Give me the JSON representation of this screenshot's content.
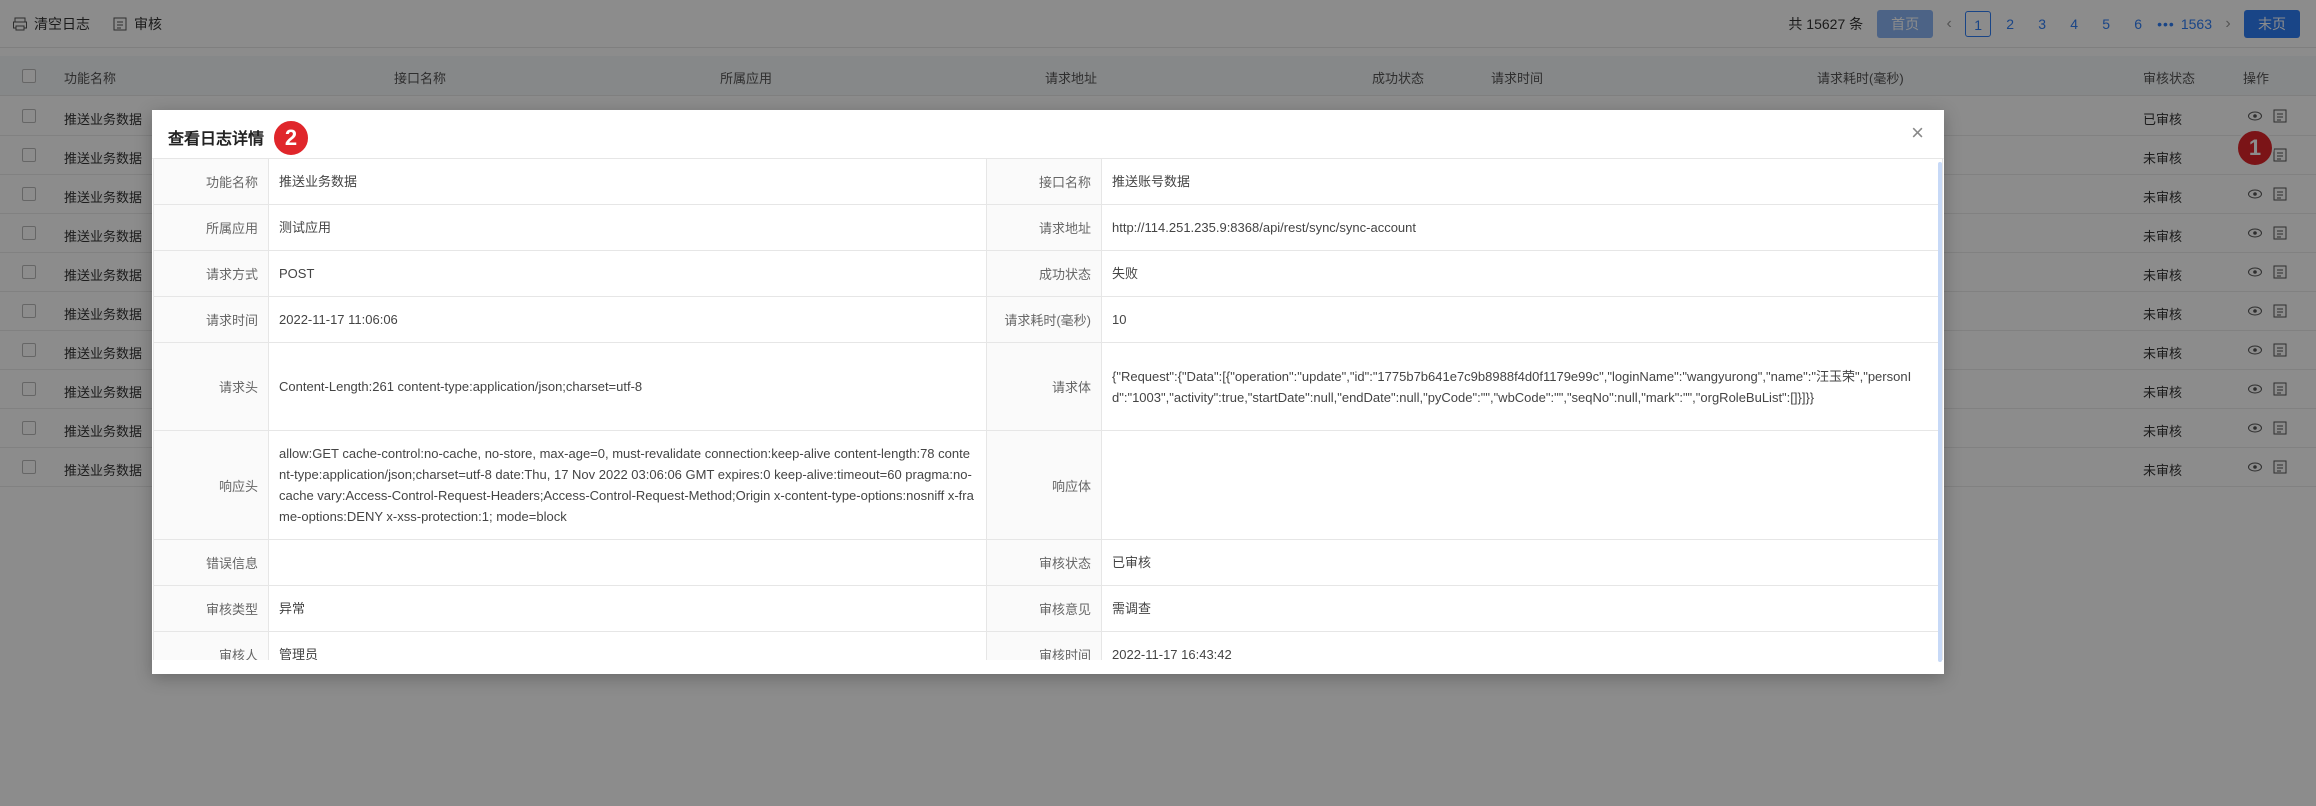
{
  "toolbar": {
    "clear_log_label": "清空日志",
    "audit_label": "审核"
  },
  "pagination": {
    "total": "共 15627 条",
    "first_label": "首页",
    "pages": [
      "1",
      "2",
      "3",
      "4",
      "5",
      "6"
    ],
    "ellipsis": "•••",
    "last_page": "1563",
    "last_label": "末页"
  },
  "table": {
    "headers": [
      "功能名称",
      "接口名称",
      "所属应用",
      "请求地址",
      "成功状态",
      "请求时间",
      "请求耗时(毫秒)",
      "审核状态",
      "操作"
    ],
    "rows": [
      {
        "name": "推送业务数据",
        "status": "已审核"
      },
      {
        "name": "推送业务数据",
        "status": "未审核"
      },
      {
        "name": "推送业务数据",
        "status": "未审核"
      },
      {
        "name": "推送业务数据",
        "status": "未审核"
      },
      {
        "name": "推送业务数据",
        "status": "未审核"
      },
      {
        "name": "推送业务数据",
        "status": "未审核"
      },
      {
        "name": "推送业务数据",
        "status": "未审核"
      },
      {
        "name": "推送业务数据",
        "status": "未审核"
      },
      {
        "name": "推送业务数据",
        "status": "未审核"
      },
      {
        "name": "推送业务数据",
        "status": "未审核"
      }
    ]
  },
  "badges": {
    "one": "1",
    "two": "2"
  },
  "modal": {
    "title": "查看日志详情",
    "close": "×",
    "fields": [
      {
        "label_l": "功能名称",
        "value_l": "推送业务数据",
        "label_r": "接口名称",
        "value_r": "推送账号数据"
      },
      {
        "label_l": "所属应用",
        "value_l": "测试应用",
        "label_r": "请求地址",
        "value_r": "http://114.251.235.9:8368/api/rest/sync/sync-account"
      },
      {
        "label_l": "请求方式",
        "value_l": "POST",
        "label_r": "成功状态",
        "value_r": "失败"
      },
      {
        "label_l": "请求时间",
        "value_l": "2022-11-17 11:06:06",
        "label_r": "请求耗时(毫秒)",
        "value_r": "10"
      },
      {
        "label_l": "请求头",
        "value_l": "Content-Length:261 content-type:application/json;charset=utf-8",
        "label_r": "请求体",
        "value_r": "{\"Request\":{\"Data\":[{\"operation\":\"update\",\"id\":\"1775b7b641e7c9b8988f4d0f1179e99c\",\"loginName\":\"wangyurong\",\"name\":\"汪玉荣\",\"personId\":\"1003\",\"activity\":true,\"startDate\":null,\"endDate\":null,\"pyCode\":\"\",\"wbCode\":\"\",\"seqNo\":null,\"mark\":\"\",\"orgRoleBuList\":[]}]}}"
      },
      {
        "label_l": "响应头",
        "value_l": "allow:GET cache-control:no-cache, no-store, max-age=0, must-revalidate connection:keep-alive content-length:78 content-type:application/json;charset=utf-8 date:Thu, 17 Nov 2022 03:06:06 GMT expires:0 keep-alive:timeout=60 pragma:no-cache vary:Access-Control-Request-Headers;Access-Control-Request-Method;Origin x-content-type-options:nosniff x-frame-options:DENY x-xss-protection:1; mode=block",
        "label_r": "响应体",
        "value_r": ""
      },
      {
        "label_l": "错误信息",
        "value_l": "",
        "label_r": "审核状态",
        "value_r": "已审核"
      },
      {
        "label_l": "审核类型",
        "value_l": "异常",
        "label_r": "审核意见",
        "value_r": "需调查"
      },
      {
        "label_l": "审核人",
        "value_l": "管理员",
        "label_r": "审核时间",
        "value_r": "2022-11-17 16:43:42"
      }
    ]
  },
  "colors": {
    "primary": "#2f7ef6",
    "badge": "#e0262b"
  }
}
